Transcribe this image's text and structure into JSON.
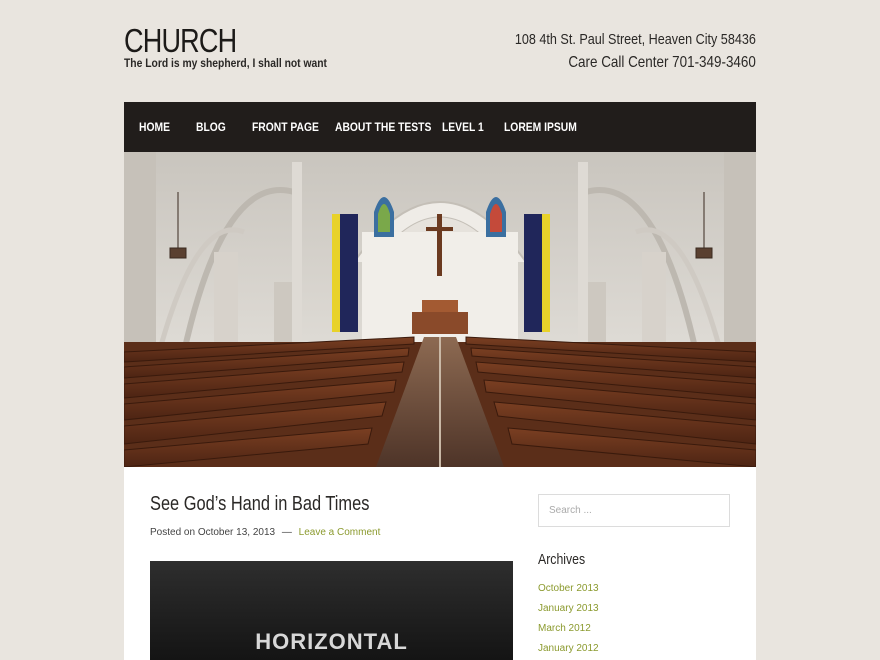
{
  "header": {
    "site_title": "CHURCH",
    "tagline": "The Lord is my shepherd, I shall not want",
    "address": "108 4th St. Paul Street, Heaven City 58436",
    "phone": "Care Call Center 701-349-3460"
  },
  "nav": {
    "items": [
      {
        "label": "HOME"
      },
      {
        "label": "BLOG"
      },
      {
        "label": "FRONT PAGE"
      },
      {
        "label": "ABOUT THE TESTS"
      },
      {
        "label": "LEVEL 1"
      },
      {
        "label": "LOREM IPSUM"
      }
    ]
  },
  "post": {
    "title": "See God’s Hand in Bad Times",
    "posted_on": "Posted on October 13, 2013",
    "separator": "—",
    "comment_link": "Leave a Comment",
    "image_text": "HORIZONTAL"
  },
  "sidebar": {
    "search_placeholder": "Search ...",
    "archives_title": "Archives",
    "archives": [
      {
        "label": "October 2013"
      },
      {
        "label": "January 2013"
      },
      {
        "label": "March 2012"
      },
      {
        "label": "January 2012"
      }
    ]
  },
  "colors": {
    "background": "#e9e5df",
    "nav_background": "#211d1b",
    "link_accent": "#8b9a2e"
  }
}
